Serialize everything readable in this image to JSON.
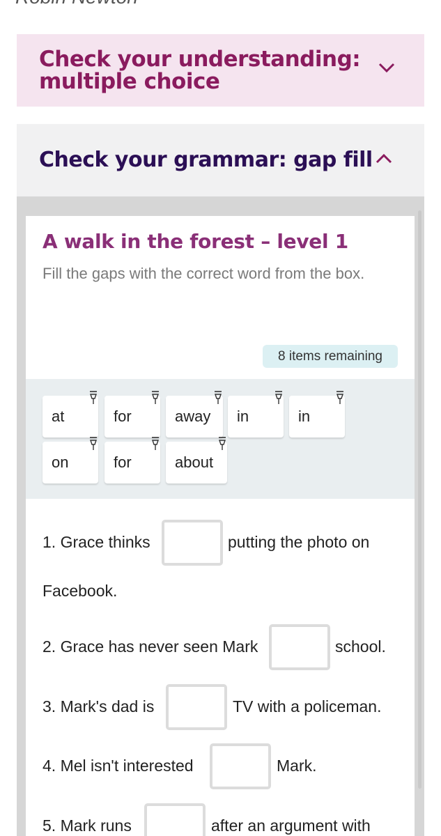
{
  "author_partial": "Robin Newton",
  "accordion_collapsed": {
    "title_line1": "Check your understanding:",
    "title_line2": "multiple choice"
  },
  "accordion_open": {
    "title": "Check your grammar: gap fill"
  },
  "exercise": {
    "title": "A walk in the forest – level 1",
    "instruction": "Fill the gaps with the correct word from the box.",
    "remaining": "8 items remaining",
    "word_bank": [
      "at",
      "for",
      "away",
      "in",
      "in",
      "on",
      "for",
      "about"
    ],
    "questions": [
      {
        "before": "1. Grace thinks",
        "after": "putting the photo on",
        "continuation": "Facebook."
      },
      {
        "before": "2. Grace has never seen Mark",
        "after": "school."
      },
      {
        "before": "3. Mark's dad is",
        "after": "TV with a policeman."
      },
      {
        "before": "4. Mel isn't interested",
        "after": "Mark."
      },
      {
        "before": "5. Mark runs",
        "after": "after an argument with"
      }
    ]
  },
  "colors": {
    "accent_magenta": "#8a1b5e",
    "accent_purple": "#2b0f55",
    "title_purple": "#8a2f77",
    "badge_bg": "#dcf0f3",
    "bank_bg": "#e9eef0"
  },
  "icons": {
    "collapsed_toggle": "chevron-down-icon",
    "open_toggle": "chevron-up-icon",
    "chip_pin": "pin-icon"
  }
}
